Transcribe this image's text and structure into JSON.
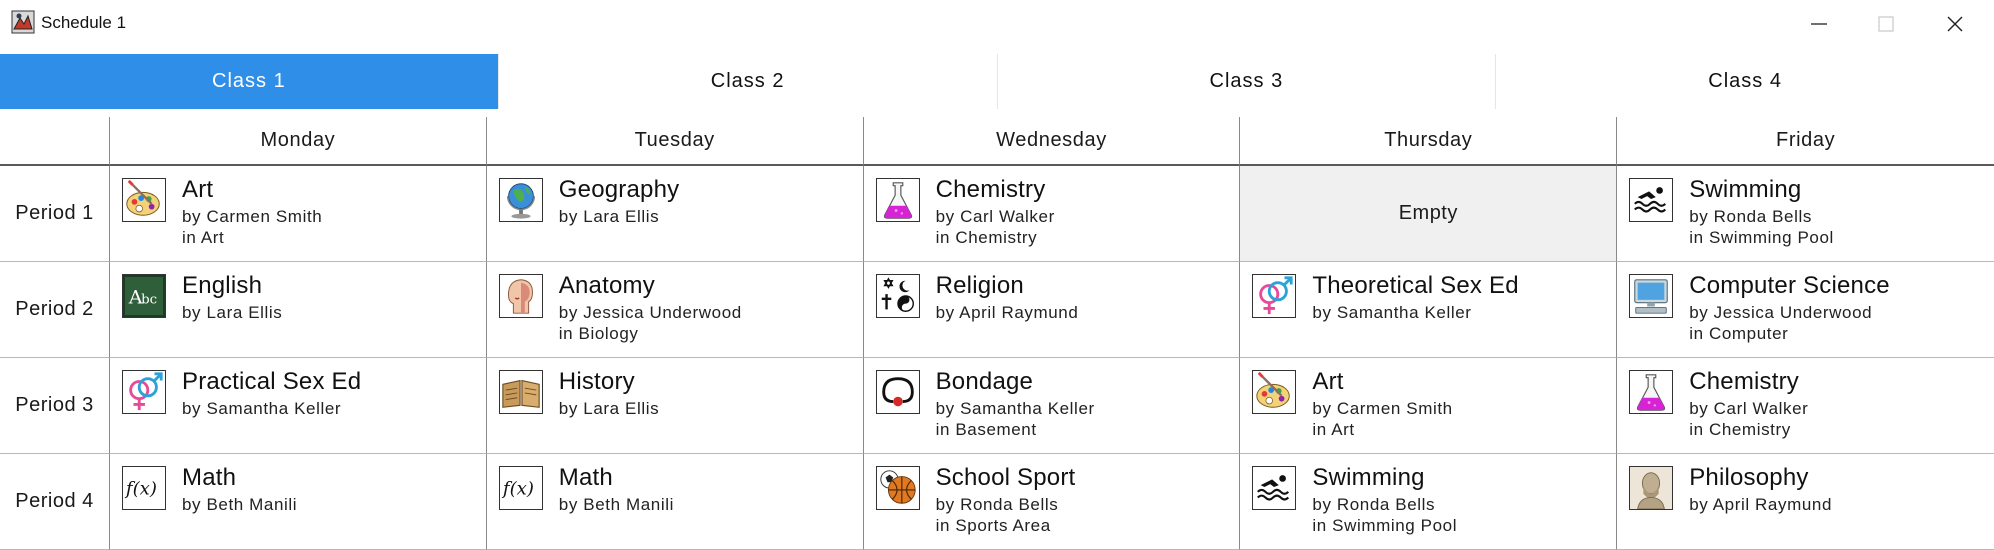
{
  "window": {
    "title": "Schedule 1"
  },
  "tabs": [
    {
      "label": "Class 1",
      "active": true
    },
    {
      "label": "Class 2",
      "active": false
    },
    {
      "label": "Class 3",
      "active": false
    },
    {
      "label": "Class 4",
      "active": false
    }
  ],
  "days": [
    "Monday",
    "Tuesday",
    "Wednesday",
    "Thursday",
    "Friday"
  ],
  "periods": [
    "Period 1",
    "Period 2",
    "Period 3",
    "Period 4"
  ],
  "empty_label": "Empty",
  "accent_color": "#2f8fe8",
  "schedule": [
    [
      {
        "subject": "Art",
        "teacher": "by Carmen Smith",
        "room": "in Art",
        "icon": "palette-icon"
      },
      {
        "subject": "Geography",
        "teacher": "by Lara Ellis",
        "room": "",
        "icon": "globe-icon"
      },
      {
        "subject": "Chemistry",
        "teacher": "by Carl Walker",
        "room": "in Chemistry",
        "icon": "flask-icon"
      },
      null,
      {
        "subject": "Swimming",
        "teacher": "by Ronda Bells",
        "room": "in Swimming Pool",
        "icon": "swimmer-icon"
      }
    ],
    [
      {
        "subject": "English",
        "teacher": "by Lara Ellis",
        "room": "",
        "icon": "chalkboard-icon"
      },
      {
        "subject": "Anatomy",
        "teacher": "by Jessica Underwood",
        "room": "in Biology",
        "icon": "anatomy-head-icon"
      },
      {
        "subject": "Religion",
        "teacher": "by April Raymund",
        "room": "",
        "icon": "religion-symbols-icon"
      },
      {
        "subject": "Theoretical Sex Ed",
        "teacher": "by Samantha Keller",
        "room": "",
        "icon": "gender-symbols-icon"
      },
      {
        "subject": "Computer Science",
        "teacher": "by Jessica Underwood",
        "room": "in Computer",
        "icon": "computer-icon"
      }
    ],
    [
      {
        "subject": "Practical Sex Ed",
        "teacher": "by Samantha Keller",
        "room": "",
        "icon": "gender-symbols-icon"
      },
      {
        "subject": "History",
        "teacher": "by Lara Ellis",
        "room": "",
        "icon": "old-book-icon"
      },
      {
        "subject": "Bondage",
        "teacher": "by Samantha Keller",
        "room": "in Basement",
        "icon": "ball-gag-icon"
      },
      {
        "subject": "Art",
        "teacher": "by Carmen Smith",
        "room": "in Art",
        "icon": "palette-icon"
      },
      {
        "subject": "Chemistry",
        "teacher": "by Carl Walker",
        "room": "in Chemistry",
        "icon": "flask-icon"
      }
    ],
    [
      {
        "subject": "Math",
        "teacher": "by Beth Manili",
        "room": "",
        "icon": "function-icon"
      },
      {
        "subject": "Math",
        "teacher": "by Beth Manili",
        "room": "",
        "icon": "function-icon"
      },
      {
        "subject": "School Sport",
        "teacher": "by Ronda Bells",
        "room": "in Sports Area",
        "icon": "sports-balls-icon"
      },
      {
        "subject": "Swimming",
        "teacher": "by Ronda Bells",
        "room": "in Swimming Pool",
        "icon": "swimmer-icon"
      },
      {
        "subject": "Philosophy",
        "teacher": "by April Raymund",
        "room": "",
        "icon": "bust-icon"
      }
    ]
  ]
}
